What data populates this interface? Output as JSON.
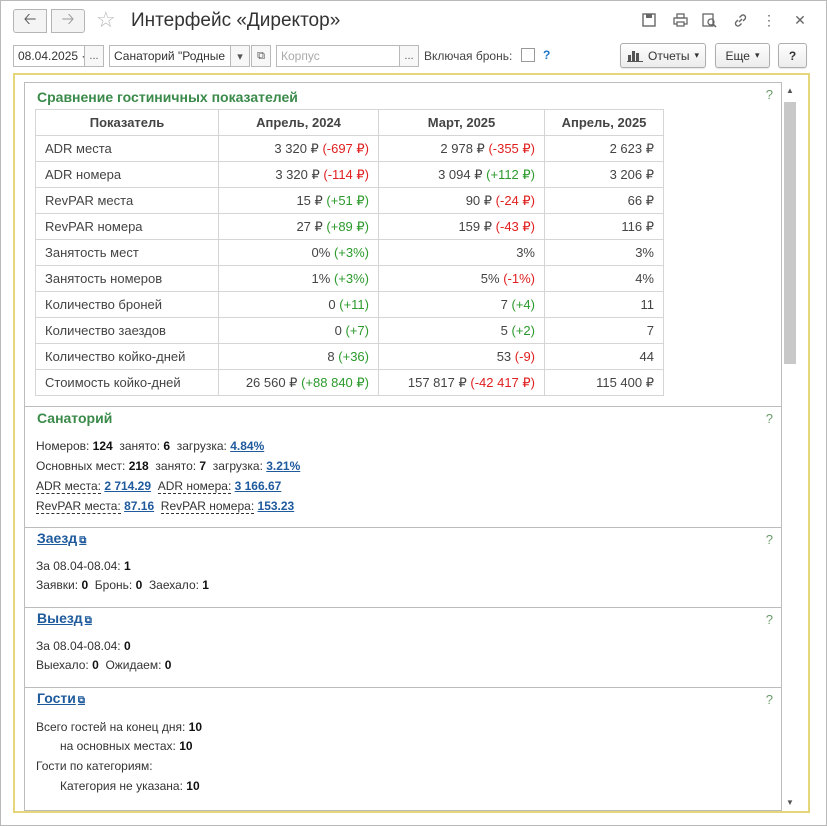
{
  "window": {
    "title": "Интерфейс «Директор»"
  },
  "toolbar": {
    "date_value": "08.04.2025 ·",
    "sanatorium_value": "Санаторий \"Родные",
    "corpus_placeholder": "Корпус",
    "include_booking_label": "Включая бронь:",
    "help_mark": "?",
    "reports_label": "Отчеты",
    "more_label": "Еще",
    "help_label": "?"
  },
  "comparison": {
    "title": "Сравнение гостиничных показателей",
    "help": "?",
    "headers": [
      "Показатель",
      "Апрель, 2024",
      "Март, 2025",
      "Апрель, 2025"
    ],
    "rows": [
      {
        "name": "ADR места",
        "c1": "3 320 ₽",
        "c1d": "(-697 ₽)",
        "c1s": "neg",
        "c2": "2 978 ₽",
        "c2d": "(-355 ₽)",
        "c2s": "neg",
        "c3": "2 623 ₽"
      },
      {
        "name": "ADR номера",
        "c1": "3 320 ₽",
        "c1d": "(-114 ₽)",
        "c1s": "neg",
        "c2": "3 094 ₽",
        "c2d": "(+112 ₽)",
        "c2s": "pos",
        "c3": "3 206 ₽"
      },
      {
        "name": "RevPAR места",
        "c1": "15 ₽",
        "c1d": "(+51 ₽)",
        "c1s": "pos",
        "c2": "90 ₽",
        "c2d": "(-24 ₽)",
        "c2s": "neg",
        "c3": "66 ₽"
      },
      {
        "name": "RevPAR номера",
        "c1": "27 ₽",
        "c1d": "(+89 ₽)",
        "c1s": "pos",
        "c2": "159 ₽",
        "c2d": "(-43 ₽)",
        "c2s": "neg",
        "c3": "116 ₽"
      },
      {
        "name": "Занятость мест",
        "c1": "0%",
        "c1d": "(+3%)",
        "c1s": "pos",
        "c2": "3%",
        "c2d": "",
        "c2s": "",
        "c3": "3%"
      },
      {
        "name": "Занятость номеров",
        "c1": "1%",
        "c1d": "(+3%)",
        "c1s": "pos",
        "c2": "5%",
        "c2d": "(-1%)",
        "c2s": "neg",
        "c3": "4%"
      },
      {
        "name": "Количество броней",
        "c1": "0",
        "c1d": "(+11)",
        "c1s": "pos",
        "c2": "7",
        "c2d": "(+4)",
        "c2s": "pos",
        "c3": "11"
      },
      {
        "name": "Количество заездов",
        "c1": "0",
        "c1d": "(+7)",
        "c1s": "pos",
        "c2": "5",
        "c2d": "(+2)",
        "c2s": "pos",
        "c3": "7"
      },
      {
        "name": "Количество койко-дней",
        "c1": "8",
        "c1d": "(+36)",
        "c1s": "pos",
        "c2": "53",
        "c2d": "(-9)",
        "c2s": "neg",
        "c3": "44"
      },
      {
        "name": "Стоимость койко-дней",
        "c1": "26 560 ₽",
        "c1d": "(+88 840 ₽)",
        "c1s": "pos",
        "c2": "157 817 ₽",
        "c2d": "(-42 417 ₽)",
        "c2s": "neg",
        "c3": "115 400 ₽"
      }
    ]
  },
  "sanatorium": {
    "title": "Санаторий",
    "help": "?",
    "rooms_label": "Номеров:",
    "rooms_value": "124",
    "occupied_label": "занято:",
    "rooms_occupied": "6",
    "load_label": "загрузка:",
    "rooms_load": "4.84%",
    "beds_label": "Основных мест:",
    "beds_value": "218",
    "beds_occupied": "7",
    "beds_load": "3.21%",
    "adr_place_label": "ADR места:",
    "adr_place_value": "2 714.29",
    "adr_room_label": "ADR номера:",
    "adr_room_value": "3 166.67",
    "revpar_place_label": "RevPAR места:",
    "revpar_place_value": "87.16",
    "revpar_room_label": "RevPAR номера:",
    "revpar_room_value": "153.23"
  },
  "arrival": {
    "title": "Заезд",
    "help": "?",
    "period_label": "За 08.04-08.04:",
    "period_value": "1",
    "requests_label": "Заявки:",
    "requests_value": "0",
    "booking_label": "Бронь:",
    "booking_value": "0",
    "arrived_label": "Заехало:",
    "arrived_value": "1"
  },
  "departure": {
    "title": "Выезд",
    "help": "?",
    "period_label": "За 08.04-08.04:",
    "period_value": "0",
    "left_label": "Выехало:",
    "left_value": "0",
    "waiting_label": "Ожидаем:",
    "waiting_value": "0"
  },
  "guests": {
    "title": "Гости",
    "help": "?",
    "total_label": "Всего гостей на конец дня:",
    "total_value": "10",
    "main_label": "на основных местах:",
    "main_value": "10",
    "categories_label": "Гости по категориям:",
    "category_label": "Категория не указана:",
    "category_value": "10"
  }
}
